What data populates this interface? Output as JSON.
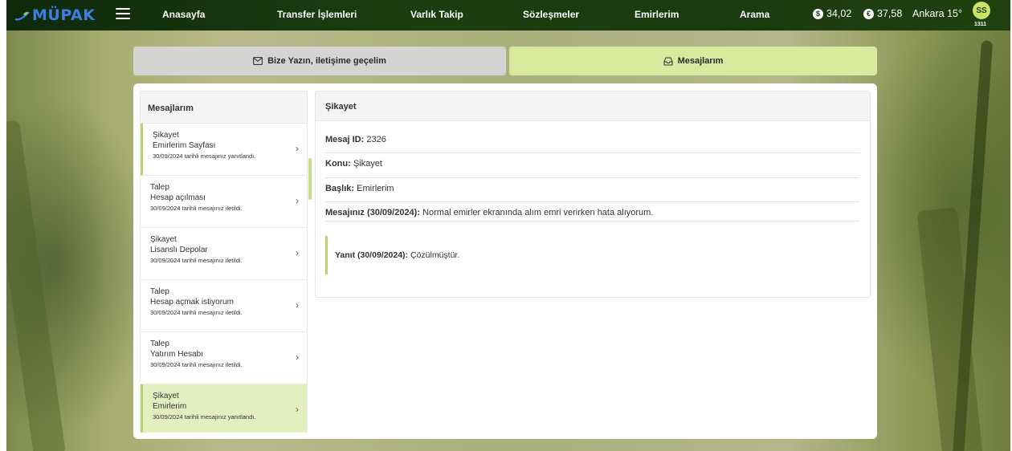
{
  "header": {
    "logo_text": "MÜPAK",
    "nav": [
      "Anasayfa",
      "Transfer İşlemleri",
      "Varlık Takip",
      "Sözleşmeler",
      "Emirlerim",
      "Arama"
    ],
    "rates": [
      {
        "icon": "dollar-icon",
        "symbol": "$",
        "value": "34,02"
      },
      {
        "icon": "euro-icon",
        "symbol": "€",
        "value": "37,58"
      }
    ],
    "weather": "Ankara 15°",
    "user_initials": "SS",
    "user_code": "1311"
  },
  "tabs": {
    "contact_label": "Bize Yazın, iletişime geçelim",
    "messages_label": "Mesajlarım"
  },
  "list": {
    "title": "Mesajlarım",
    "items": [
      {
        "type": "Şikayet",
        "title": "Emirlerim Sayfası",
        "status": "30/09/2024 tarihli mesajınız yanıtlandı."
      },
      {
        "type": "Talep",
        "title": "Hesap açılması",
        "status": "30/09/2024 tarihli mesajınız iletildi."
      },
      {
        "type": "Şikayet",
        "title": "Lisanslı Depolar",
        "status": "30/09/2024 tarihli mesajınız iletildi."
      },
      {
        "type": "Talep",
        "title": "Hesap açmak istiyorum",
        "status": "30/09/2024 tarihli mesajınız iletildi."
      },
      {
        "type": "Talep",
        "title": "Yatırım Hesabı",
        "status": "30/09/2024 tarihli mesajınız iletildi."
      },
      {
        "type": "Şikayet",
        "title": "Emirlerim",
        "status": "30/09/2024 tarihli mesajınız yanıtlandı."
      }
    ]
  },
  "detail": {
    "title": "Şikayet",
    "id_label": "Mesaj ID:",
    "id_value": "2326",
    "subject_label": "Konu:",
    "subject_value": "Şikayet",
    "heading_label": "Başlık:",
    "heading_value": "Emirlerim",
    "message_label": "Mesajınız (30/09/2024):",
    "message_value": "Normal emirler ekranında alım emri verirken hata alıyorum.",
    "reply_label": "Yanıt (30/09/2024):",
    "reply_value": "Çözülmüştür."
  },
  "colors": {
    "topbar": "#1d3d10",
    "accent": "#d9ea9e",
    "accent_border": "#b7d470",
    "logo": "#3f7de6"
  }
}
